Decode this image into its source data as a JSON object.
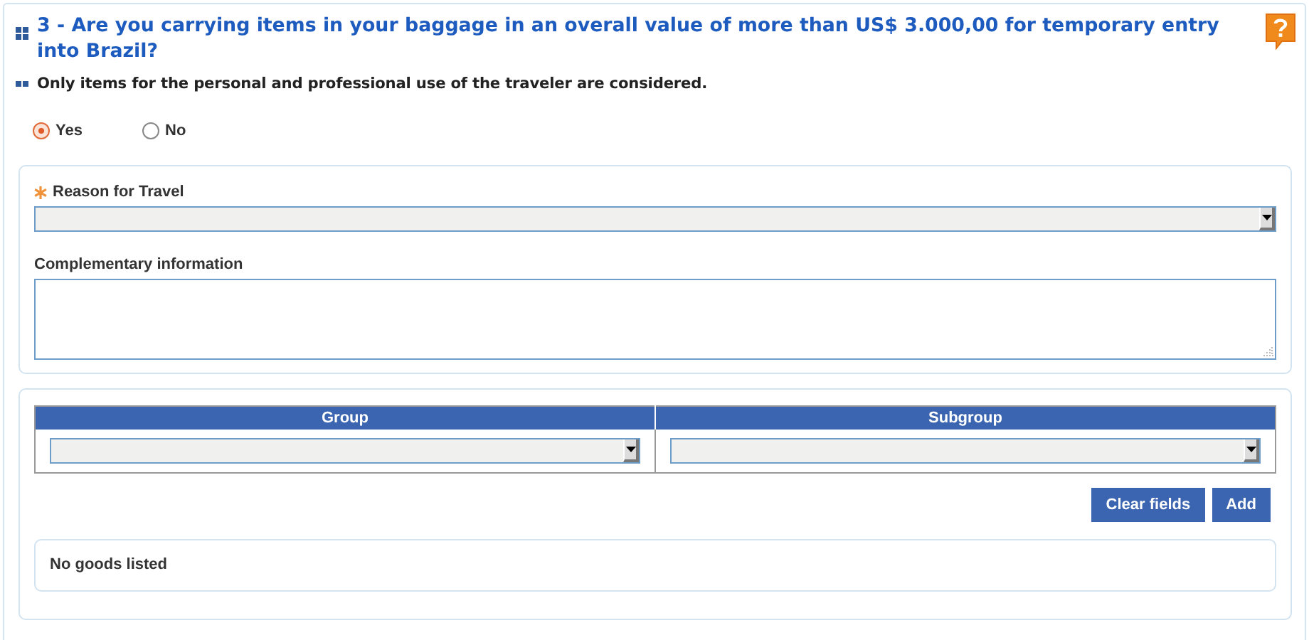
{
  "question": {
    "title": "3 - Are you carrying items in your baggage in an overall value of more than US$ 3.000,00 for temporary entry into Brazil?",
    "note": "Only items for the personal and professional use of the traveler are considered."
  },
  "answers": [
    {
      "label": "Yes",
      "selected": true
    },
    {
      "label": "No",
      "selected": false
    }
  ],
  "details": {
    "fields": [
      {
        "kind": "select",
        "label": "Reason for Travel",
        "required": true
      },
      {
        "kind": "textarea",
        "label": "Complementary information",
        "required": false
      }
    ]
  },
  "goods": {
    "columns": [
      "Group",
      "Subgroup"
    ],
    "buttons": [
      "Clear fields",
      "Add"
    ],
    "empty_message": "No goods listed"
  }
}
